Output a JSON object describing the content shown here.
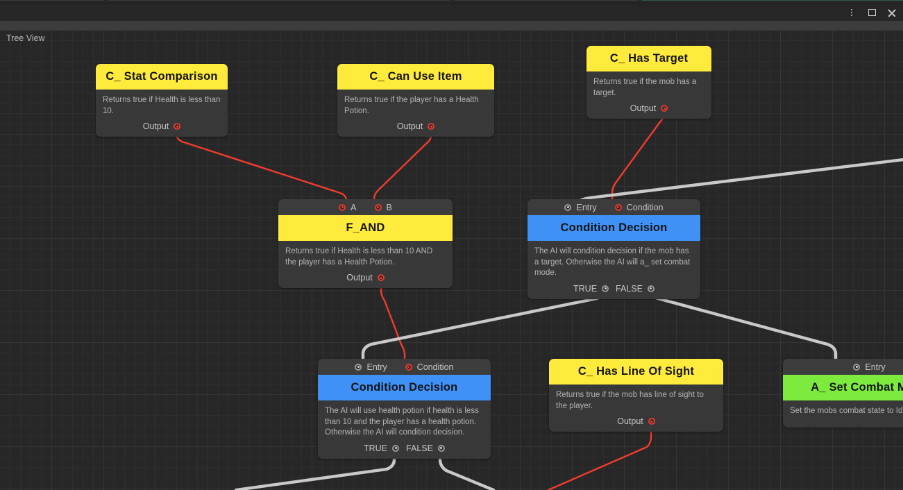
{
  "window": {
    "controls": [
      {
        "name": "kebab-menu-icon",
        "glyph": "⋮"
      },
      {
        "name": "maximize-icon",
        "glyph": "▢"
      },
      {
        "name": "close-icon",
        "glyph": "✕"
      }
    ]
  },
  "canvas": {
    "view_label": "Tree View",
    "grid_minor": "#2e2e2e",
    "grid_major": "#343434",
    "background": "#272727"
  },
  "colors": {
    "condition_header": "#ffeb3b",
    "decision_header": "#3f91f5",
    "action_header": "#7ceb3e",
    "data_edge": "#f03c2e",
    "flow_edge": "#c9c9c9",
    "port_red": "#e23b2e",
    "port_gray": "#9a9a9a"
  },
  "nodes": [
    {
      "id": "stat-comparison",
      "title": "C_ Stat Comparison",
      "header_color": "yellow",
      "description": "Returns true if Health is less than 10.",
      "inputs": [],
      "outputs": [
        {
          "label": "Output",
          "port": "red"
        }
      ]
    },
    {
      "id": "can-use-item",
      "title": "C_ Can Use Item",
      "header_color": "yellow",
      "description": "Returns true if the player has a Health Potion.",
      "inputs": [],
      "outputs": [
        {
          "label": "Output",
          "port": "red"
        }
      ]
    },
    {
      "id": "has-target",
      "title": "C_ Has Target",
      "header_color": "yellow",
      "description": "Returns true if the mob has a target.",
      "inputs": [],
      "outputs": [
        {
          "label": "Output",
          "port": "red"
        }
      ]
    },
    {
      "id": "f-and",
      "title": "F_AND",
      "header_color": "yellow",
      "description": "Returns true if Health is less than 10 AND the player has a Health Potion.",
      "inputs": [
        {
          "label": "A",
          "port": "red"
        },
        {
          "label": "B",
          "port": "red"
        }
      ],
      "outputs": [
        {
          "label": "Output",
          "port": "red"
        }
      ]
    },
    {
      "id": "condition-decision-1",
      "title": "Condition Decision",
      "header_color": "blue",
      "description": "The AI will condition decision if the mob has a target. Otherwise the AI will a_ set combat mode.",
      "inputs": [
        {
          "label": "Entry",
          "port": "gray"
        },
        {
          "label": "Condition",
          "port": "red"
        }
      ],
      "outputs": [
        {
          "label": "TRUE",
          "port": "gray"
        },
        {
          "label": "FALSE",
          "port": "gray"
        }
      ]
    },
    {
      "id": "condition-decision-2",
      "title": "Condition Decision",
      "header_color": "blue",
      "description": "The AI will use health potion if health is less than 10 and the player has a health potion. Otherwise the AI will condition decision.",
      "inputs": [
        {
          "label": "Entry",
          "port": "gray"
        },
        {
          "label": "Condition",
          "port": "red"
        }
      ],
      "outputs": [
        {
          "label": "TRUE",
          "port": "gray"
        },
        {
          "label": "FALSE",
          "port": "gray"
        }
      ]
    },
    {
      "id": "has-line-of-sight",
      "title": "C_ Has Line Of Sight",
      "header_color": "yellow",
      "description": "Returns true if the mob has line of sight to the player.",
      "inputs": [],
      "outputs": [
        {
          "label": "Output",
          "port": "red"
        }
      ]
    },
    {
      "id": "set-combat-mode",
      "title": "A_ Set Combat Mode",
      "header_color": "green",
      "description": "Set the mobs combat state to Idle",
      "inputs": [
        {
          "label": "Entry",
          "port": "gray"
        }
      ],
      "outputs": []
    }
  ]
}
